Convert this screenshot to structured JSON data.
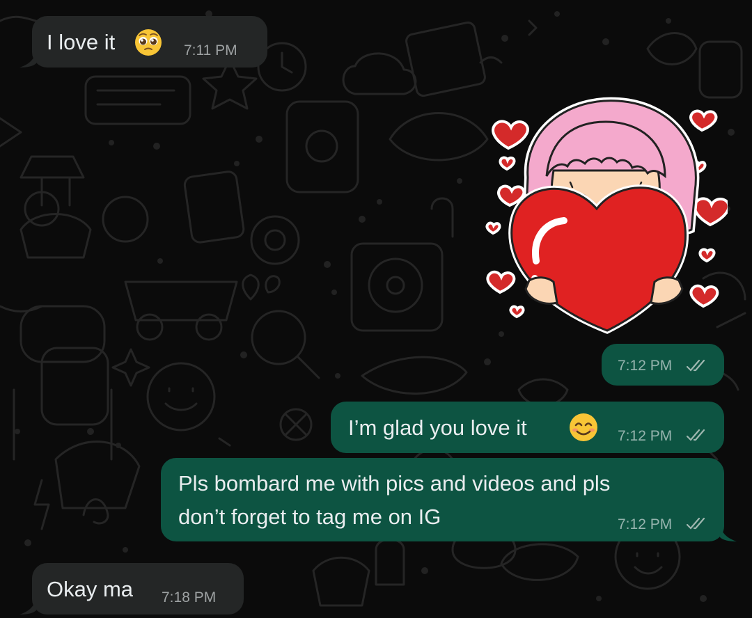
{
  "colors": {
    "background": "#0b0b0b",
    "incoming_bubble": "#242626",
    "outgoing_bubble": "#0d5442",
    "text": "#e9edef",
    "time_text": "#a3aeaa",
    "read_ticks": "#9fb7b0"
  },
  "messages": [
    {
      "direction": "incoming",
      "text": "I love it",
      "emoji": "pleading-face-emoji",
      "time": "7:11 PM"
    },
    {
      "direction": "outgoing",
      "type": "sticker",
      "sticker": "girl-hugging-heart-sticker",
      "time": "7:12 PM",
      "status": "read-double-check"
    },
    {
      "direction": "outgoing",
      "text": "I’m glad you love it",
      "emoji": "smiling-face-emoji",
      "time": "7:12 PM",
      "status": "read-double-check"
    },
    {
      "direction": "outgoing",
      "text_lines": [
        "Pls bombard me with pics and videos and pls",
        "don’t forget to tag me on IG"
      ],
      "time": "7:12 PM",
      "status": "read-double-check"
    },
    {
      "direction": "incoming",
      "text": "Okay ma",
      "time": "7:18 PM"
    }
  ]
}
